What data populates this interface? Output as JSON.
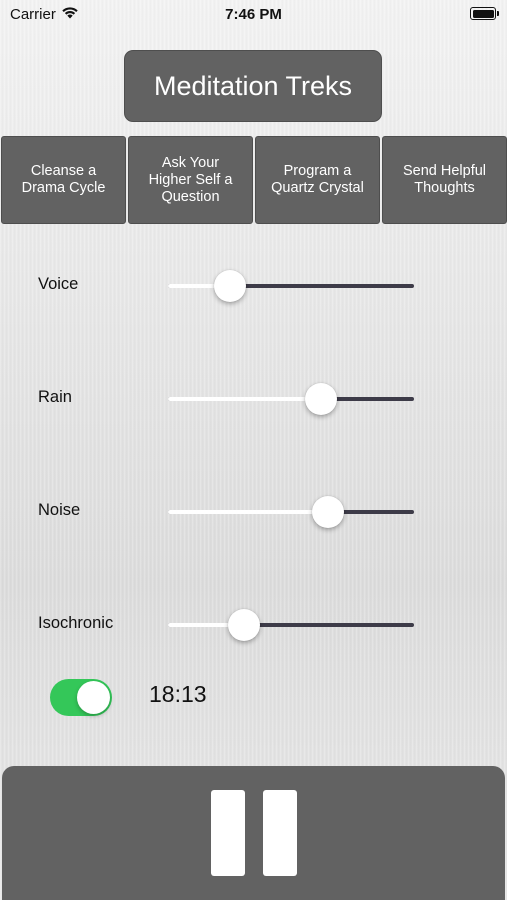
{
  "status_bar": {
    "carrier": "Carrier",
    "time": "7:46 PM"
  },
  "title": "Meditation Treks",
  "treks": [
    {
      "label": "Cleanse a\nDrama Cycle"
    },
    {
      "label": "Ask Your\nHigher Self a\nQuestion"
    },
    {
      "label": "Program a\nQuartz Crystal"
    },
    {
      "label": "Send Helpful\nThoughts"
    }
  ],
  "sliders": [
    {
      "label": "Voice",
      "value": 0.25
    },
    {
      "label": "Rain",
      "value": 0.62
    },
    {
      "label": "Noise",
      "value": 0.65
    },
    {
      "label": "Isochronic",
      "value": 0.31
    }
  ],
  "toggle": {
    "on": true
  },
  "timer": "18:13",
  "player": {
    "state": "playing",
    "icon": "pause-icon"
  },
  "colors": {
    "button_bg": "#626262",
    "toggle_on": "#34c759",
    "slider_max_track": "#3d3b48"
  }
}
